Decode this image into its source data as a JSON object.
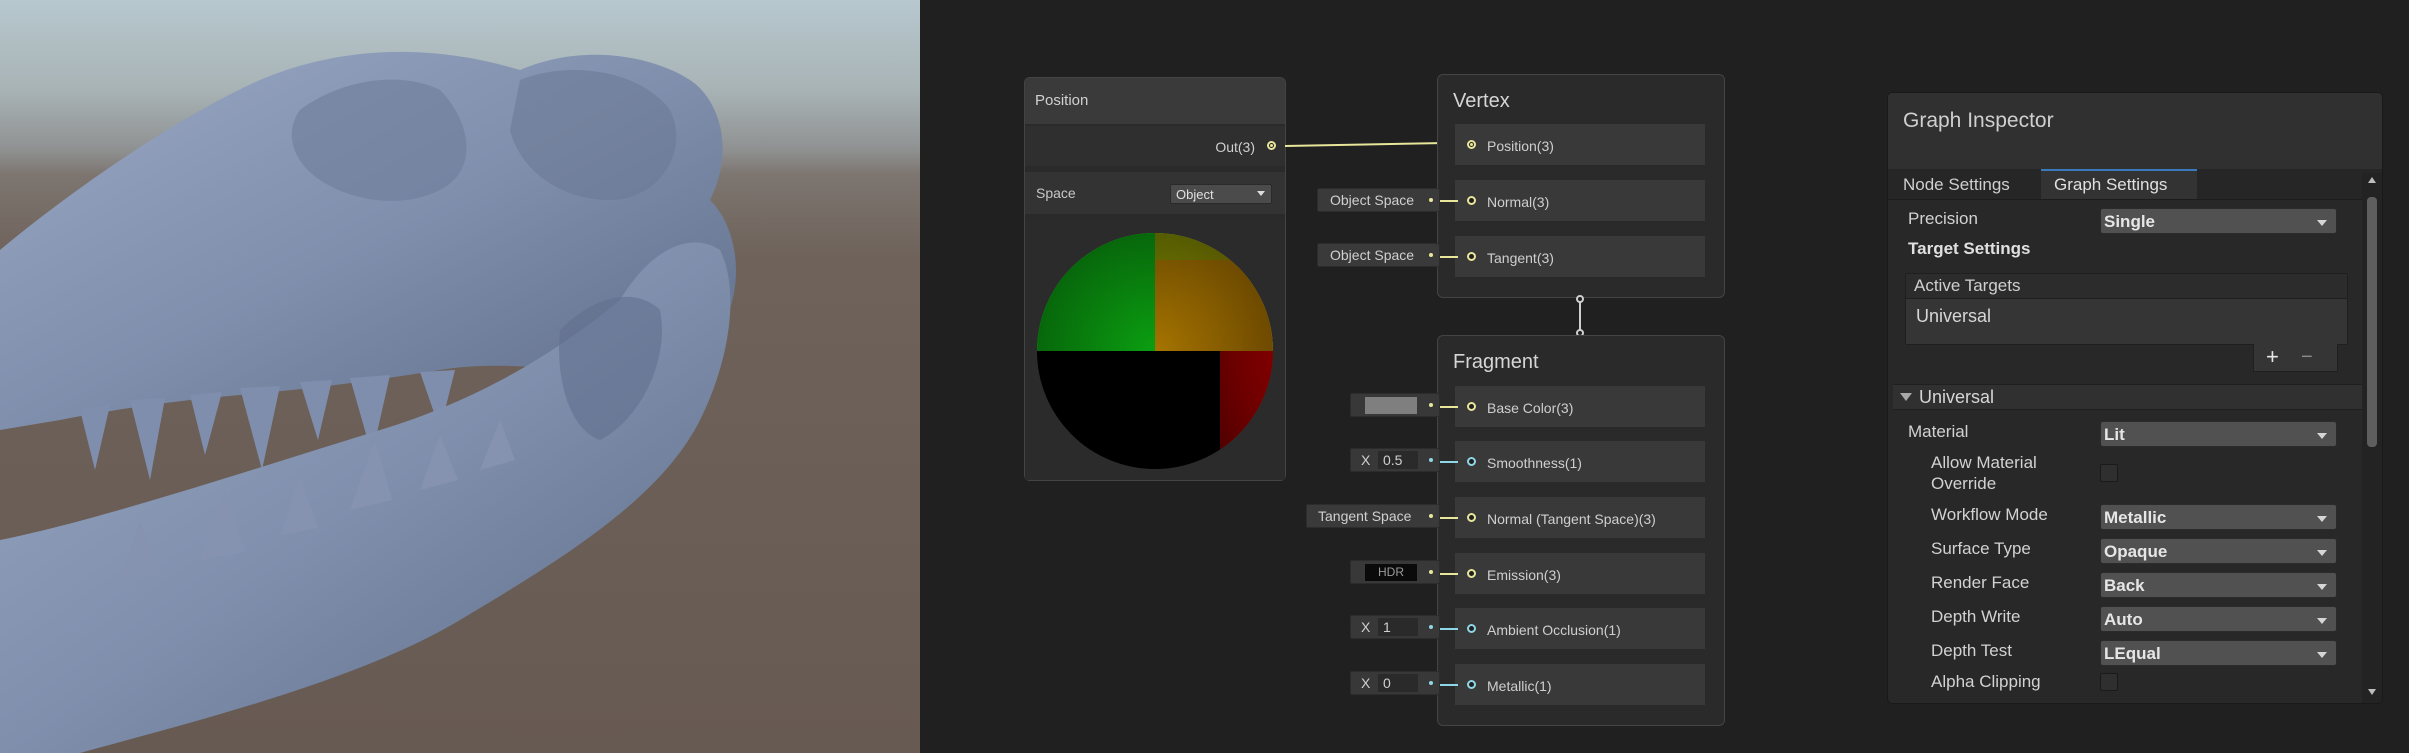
{
  "position_node": {
    "title": "Position",
    "out_label": "Out(3)",
    "space_label": "Space",
    "space_value": "Object"
  },
  "vertex_node": {
    "title": "Vertex",
    "ports": [
      {
        "label": "Position(3)"
      },
      {
        "label": "Normal(3)",
        "input": "Object Space"
      },
      {
        "label": "Tangent(3)",
        "input": "Object Space"
      }
    ]
  },
  "fragment_node": {
    "title": "Fragment",
    "ports": [
      {
        "label": "Base Color(3)"
      },
      {
        "label": "Smoothness(1)",
        "input_prefix": "X",
        "input": "0.5"
      },
      {
        "label": "Normal (Tangent Space)(3)",
        "input": "Tangent Space"
      },
      {
        "label": "Emission(3)",
        "input": "HDR"
      },
      {
        "label": "Ambient Occlusion(1)",
        "input_prefix": "X",
        "input": "1"
      },
      {
        "label": "Metallic(1)",
        "input_prefix": "X",
        "input": "0"
      }
    ]
  },
  "inspector": {
    "title": "Graph Inspector",
    "tabs": [
      "Node Settings",
      "Graph Settings"
    ],
    "active_tab": "Graph Settings",
    "precision_label": "Precision",
    "precision_value": "Single",
    "target_settings_label": "Target Settings",
    "active_targets_label": "Active Targets",
    "target_item": "Universal",
    "add_symbol": "+",
    "remove_symbol": "−",
    "section_title": "Universal",
    "settings": [
      {
        "label": "Material",
        "value": "Lit",
        "kind": "dropdown"
      },
      {
        "label": "Allow Material Override",
        "kind": "checkbox"
      },
      {
        "label": "Workflow Mode",
        "value": "Metallic",
        "kind": "dropdown"
      },
      {
        "label": "Surface Type",
        "value": "Opaque",
        "kind": "dropdown"
      },
      {
        "label": "Render Face",
        "value": "Back",
        "kind": "dropdown"
      },
      {
        "label": "Depth Write",
        "value": "Auto",
        "kind": "dropdown"
      },
      {
        "label": "Depth Test",
        "value": "LEqual",
        "kind": "dropdown"
      },
      {
        "label": "Alpha Clipping",
        "kind": "checkbox"
      }
    ]
  },
  "colors": {
    "graph_bg": "#202020",
    "wire_vector": "#e8e69a",
    "wire_float": "#8fd6e6",
    "tab_active_underline": "#3a79bb"
  }
}
